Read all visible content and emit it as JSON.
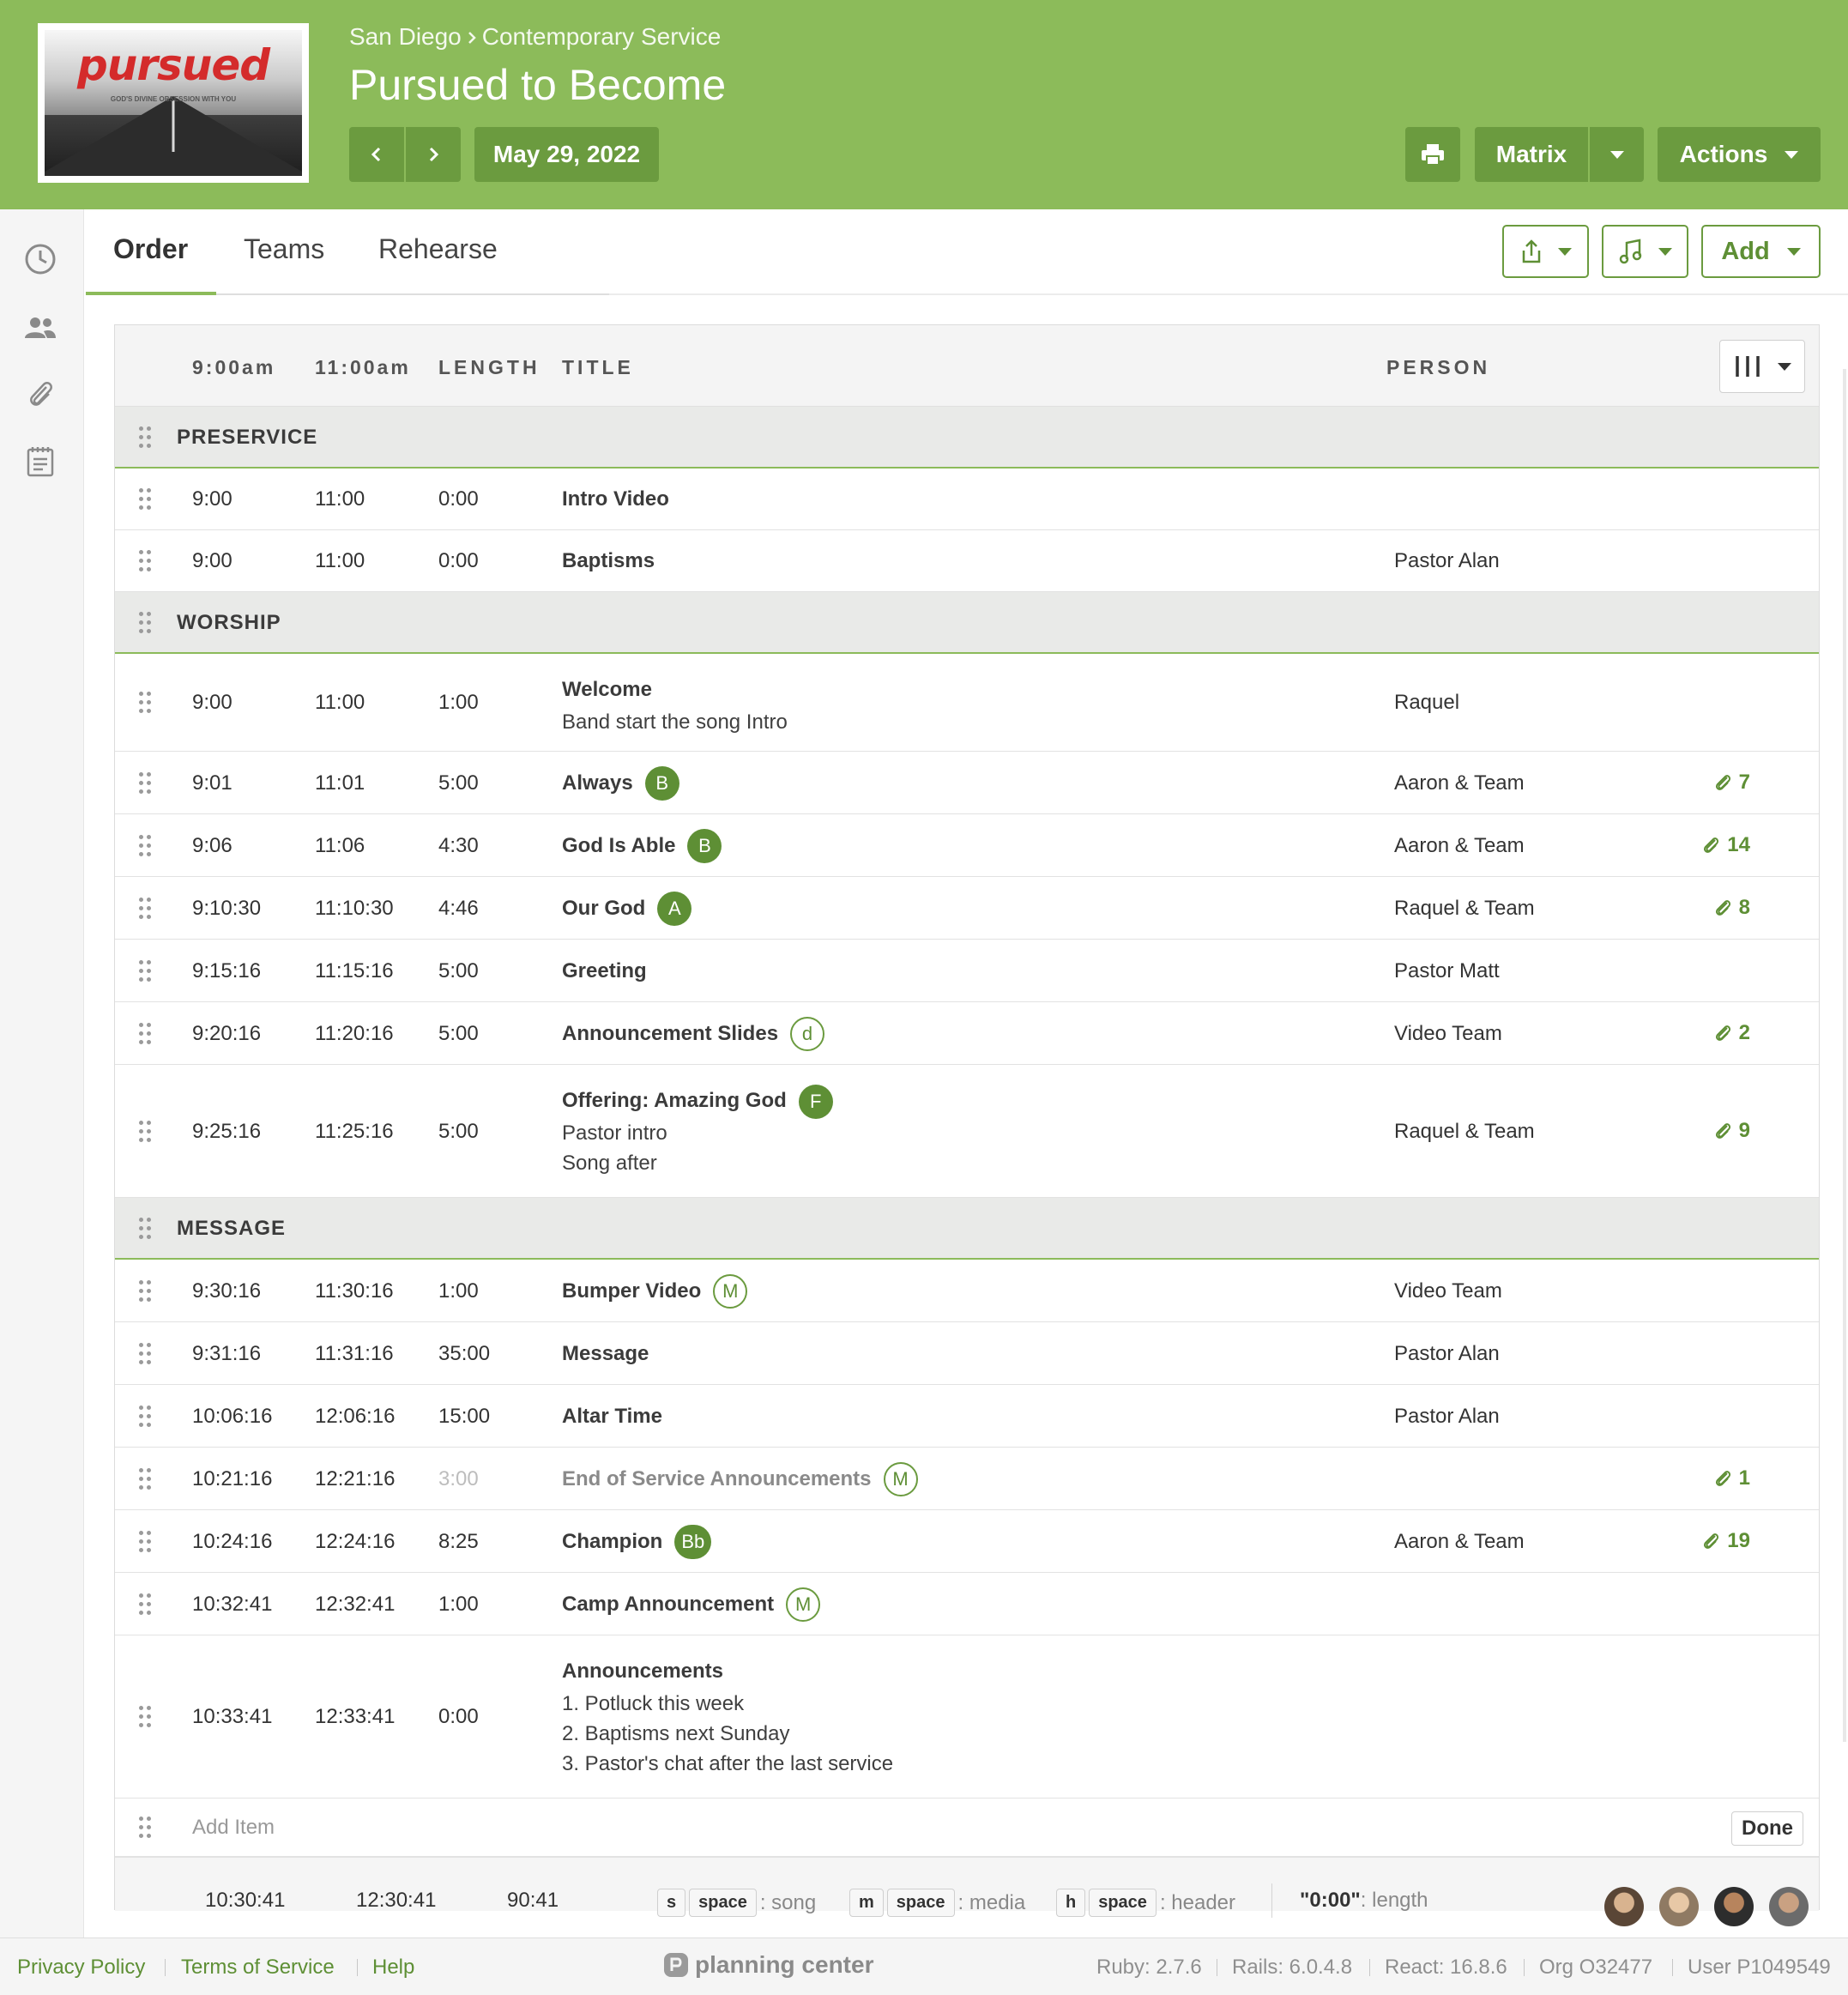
{
  "header": {
    "logo_text": "pursued",
    "logo_tagline": "GOD'S DIVINE OBSESSION WITH YOU",
    "breadcrumb": [
      "San Diego",
      "Contemporary Service"
    ],
    "title": "Pursued to Become",
    "date": "May 29, 2022",
    "matrix_label": "Matrix",
    "actions_label": "Actions"
  },
  "tabs": [
    "Order",
    "Teams",
    "Rehearse"
  ],
  "toolbar": {
    "add_label": "Add"
  },
  "columns": {
    "time1": "9:00am",
    "time2": "11:00am",
    "length": "LENGTH",
    "title": "TITLE",
    "person": "PERSON"
  },
  "sections": [
    {
      "name": "PRESERVICE",
      "items": [
        {
          "t1": "9:00",
          "t2": "11:00",
          "len": "0:00",
          "title": "Intro Video",
          "person": "",
          "attachments": ""
        },
        {
          "t1": "9:00",
          "t2": "11:00",
          "len": "0:00",
          "title": "Baptisms",
          "person": "Pastor Alan",
          "attachments": ""
        }
      ]
    },
    {
      "name": "WORSHIP",
      "items": [
        {
          "t1": "9:00",
          "t2": "11:00",
          "len": "1:00",
          "title": "Welcome",
          "notes": [
            "Band start the song Intro"
          ],
          "person": "Raquel",
          "attachments": ""
        },
        {
          "t1": "9:01",
          "t2": "11:01",
          "len": "5:00",
          "title": "Always",
          "badge": "B",
          "badge_style": "solid",
          "person": "Aaron & Team",
          "attachments": "7"
        },
        {
          "t1": "9:06",
          "t2": "11:06",
          "len": "4:30",
          "title": "God Is Able",
          "badge": "B",
          "badge_style": "solid",
          "person": "Aaron & Team",
          "attachments": "14"
        },
        {
          "t1": "9:10:30",
          "t2": "11:10:30",
          "len": "4:46",
          "title": "Our God",
          "badge": "A",
          "badge_style": "solid",
          "person": "Raquel & Team",
          "attachments": "8"
        },
        {
          "t1": "9:15:16",
          "t2": "11:15:16",
          "len": "5:00",
          "title": "Greeting",
          "person": "Pastor Matt",
          "attachments": ""
        },
        {
          "t1": "9:20:16",
          "t2": "11:20:16",
          "len": "5:00",
          "title": "Announcement Slides",
          "badge": "d",
          "badge_style": "outline",
          "person": "Video Team",
          "attachments": "2"
        },
        {
          "t1": "9:25:16",
          "t2": "11:25:16",
          "len": "5:00",
          "title": "Offering: Amazing God",
          "badge": "F",
          "badge_style": "solid",
          "notes": [
            "Pastor intro",
            "Song after"
          ],
          "person": "Raquel & Team",
          "attachments": "9"
        }
      ]
    },
    {
      "name": "MESSAGE",
      "items": [
        {
          "t1": "9:30:16",
          "t2": "11:30:16",
          "len": "1:00",
          "title": "Bumper Video",
          "badge": "M",
          "badge_style": "outline",
          "person": "Video Team",
          "attachments": ""
        },
        {
          "t1": "9:31:16",
          "t2": "11:31:16",
          "len": "35:00",
          "title": "Message",
          "person": "Pastor Alan",
          "attachments": ""
        },
        {
          "t1": "10:06:16",
          "t2": "12:06:16",
          "len": "15:00",
          "title": "Altar Time",
          "person": "Pastor Alan",
          "attachments": ""
        },
        {
          "t1": "10:21:16",
          "t2": "12:21:16",
          "len": "3:00",
          "title": "End of Service Announcements",
          "badge": "M",
          "badge_style": "outline",
          "person": "",
          "attachments": "1",
          "dimmed": true
        },
        {
          "t1": "10:24:16",
          "t2": "12:24:16",
          "len": "8:25",
          "title": "Champion",
          "badge": "Bb",
          "badge_style": "solid",
          "person": "Aaron & Team",
          "attachments": "19"
        },
        {
          "t1": "10:32:41",
          "t2": "12:32:41",
          "len": "1:00",
          "title": "Camp Announcement",
          "badge": "M",
          "badge_style": "outline",
          "person": "",
          "attachments": ""
        },
        {
          "t1": "10:33:41",
          "t2": "12:33:41",
          "len": "0:00",
          "title": "Announcements",
          "notes": [
            "1. Potluck this week",
            "2. Baptisms next Sunday",
            "3. Pastor's chat after the last service"
          ],
          "person": "",
          "attachments": ""
        }
      ]
    }
  ],
  "add_item": {
    "placeholder": "Add Item",
    "done_label": "Done"
  },
  "totals": {
    "t1": "10:30:41",
    "t2": "12:30:41",
    "length": "90:41"
  },
  "shortcuts": [
    {
      "key": "s",
      "mod": "space",
      "label": ": song"
    },
    {
      "key": "m",
      "mod": "space",
      "label": ": media"
    },
    {
      "key": "h",
      "mod": "space",
      "label": ": header"
    }
  ],
  "length_hint": {
    "key": "\"0:00\"",
    "label": ": length"
  },
  "footer": {
    "links": [
      "Privacy Policy",
      "Terms of Service",
      "Help"
    ],
    "brand": "planning center",
    "meta": [
      "Ruby: 2.7.6",
      "Rails: 6.0.4.8",
      "React: 16.8.6",
      "Org O32477",
      "User P1049549"
    ]
  },
  "colors": {
    "brand_green": "#8cbb5a",
    "button_green": "#6b9b3f",
    "accent_green": "#5e8f35"
  }
}
